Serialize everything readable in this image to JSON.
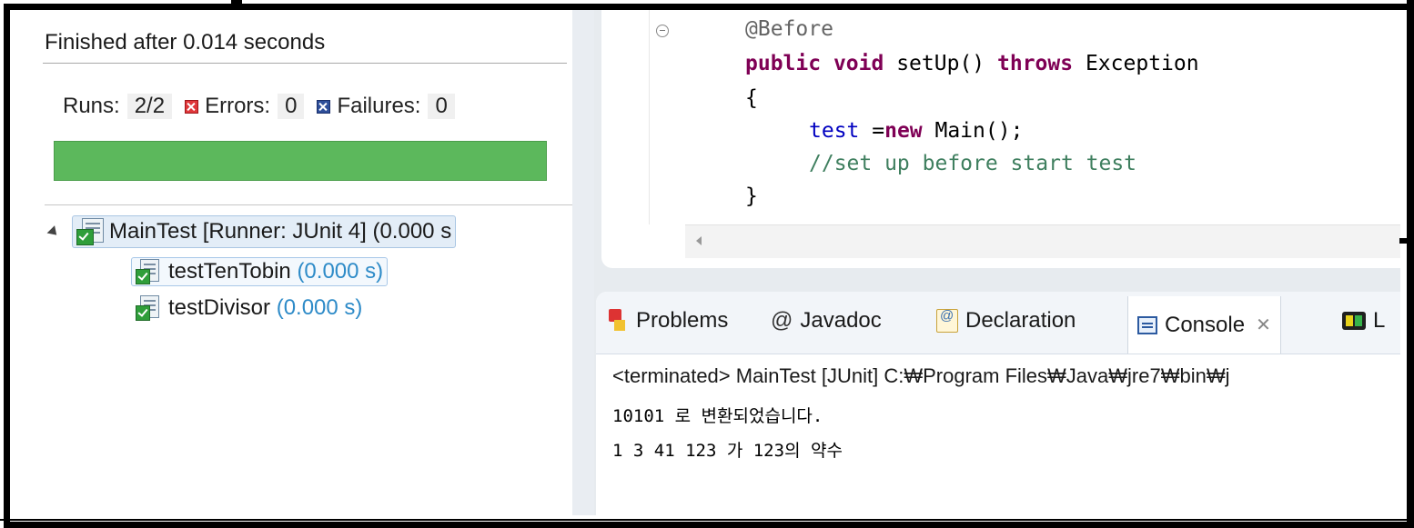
{
  "junit": {
    "finished": "Finished after 0.014 seconds",
    "runs_label": "Runs:",
    "runs_value": "2/2",
    "errors_label": "Errors:",
    "errors_value": "0",
    "failures_label": "Failures:",
    "failures_value": "0",
    "progress_status": "success",
    "progress_color": "#5cb85c",
    "suite": {
      "name": "MainTest [Runner: JUnit 4]",
      "time": "(0.000 s"
    },
    "tests": [
      {
        "name": "testTenTobin",
        "time": "(0.000 s)"
      },
      {
        "name": "testDivisor",
        "time": "(0.000 s)"
      }
    ]
  },
  "editor": {
    "lines": {
      "annotation": "@Before",
      "sig_kw1": "public",
      "sig_kw2": "void",
      "sig_name": "setUp()",
      "sig_kw3": "throws",
      "sig_exc": "Exception",
      "open_brace": "{",
      "body_field": "test",
      "body_eq": " =",
      "body_kw": "new",
      "body_call": " Main();",
      "comment": "//set up before start test",
      "close_brace": "}"
    },
    "colors": {
      "keyword": "#7f0055",
      "comment": "#3f7f5f",
      "field": "#0000c0"
    }
  },
  "tabs": {
    "problems": "Problems",
    "javadoc_icon": "@",
    "javadoc": "Javadoc",
    "declaration": "Declaration",
    "console": "Console",
    "close": "✕",
    "extra_partial": "L"
  },
  "console": {
    "header": "<terminated> MainTest [JUnit] C:₩Program Files₩Java₩jre7₩bin₩j",
    "output": [
      "10101 로 변환되었습니다.",
      "1 3 41 123 가 123의 약수"
    ]
  }
}
